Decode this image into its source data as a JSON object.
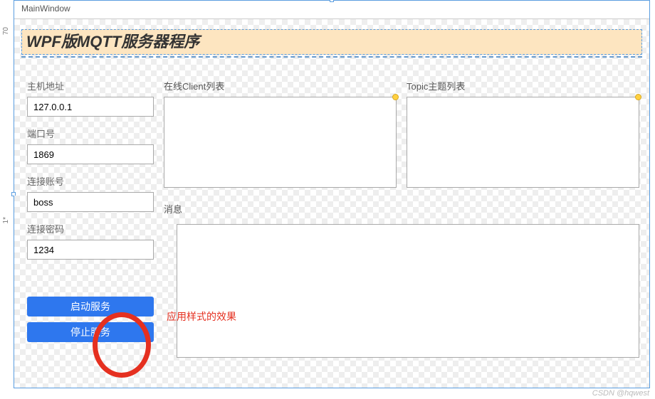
{
  "ruler": {
    "top_mark": "70",
    "mid_mark": "1*"
  },
  "window": {
    "title": "MainWindow"
  },
  "banner": {
    "title": "WPF版MQTT服务器程序"
  },
  "form": {
    "host_label": "主机地址",
    "host_value": "127.0.0.1",
    "port_label": "端口号",
    "port_value": "1869",
    "account_label": "连接账号",
    "account_value": "boss",
    "password_label": "连接密码",
    "password_value": "1234"
  },
  "buttons": {
    "start_label": "启动服务",
    "stop_label": "停止服务"
  },
  "lists": {
    "client_label": "在线Client列表",
    "topic_label": "Topic主题列表",
    "message_label": "消息"
  },
  "annotation": {
    "text": "应用样式的效果"
  },
  "watermark": {
    "text": "CSDN @hqwest"
  }
}
